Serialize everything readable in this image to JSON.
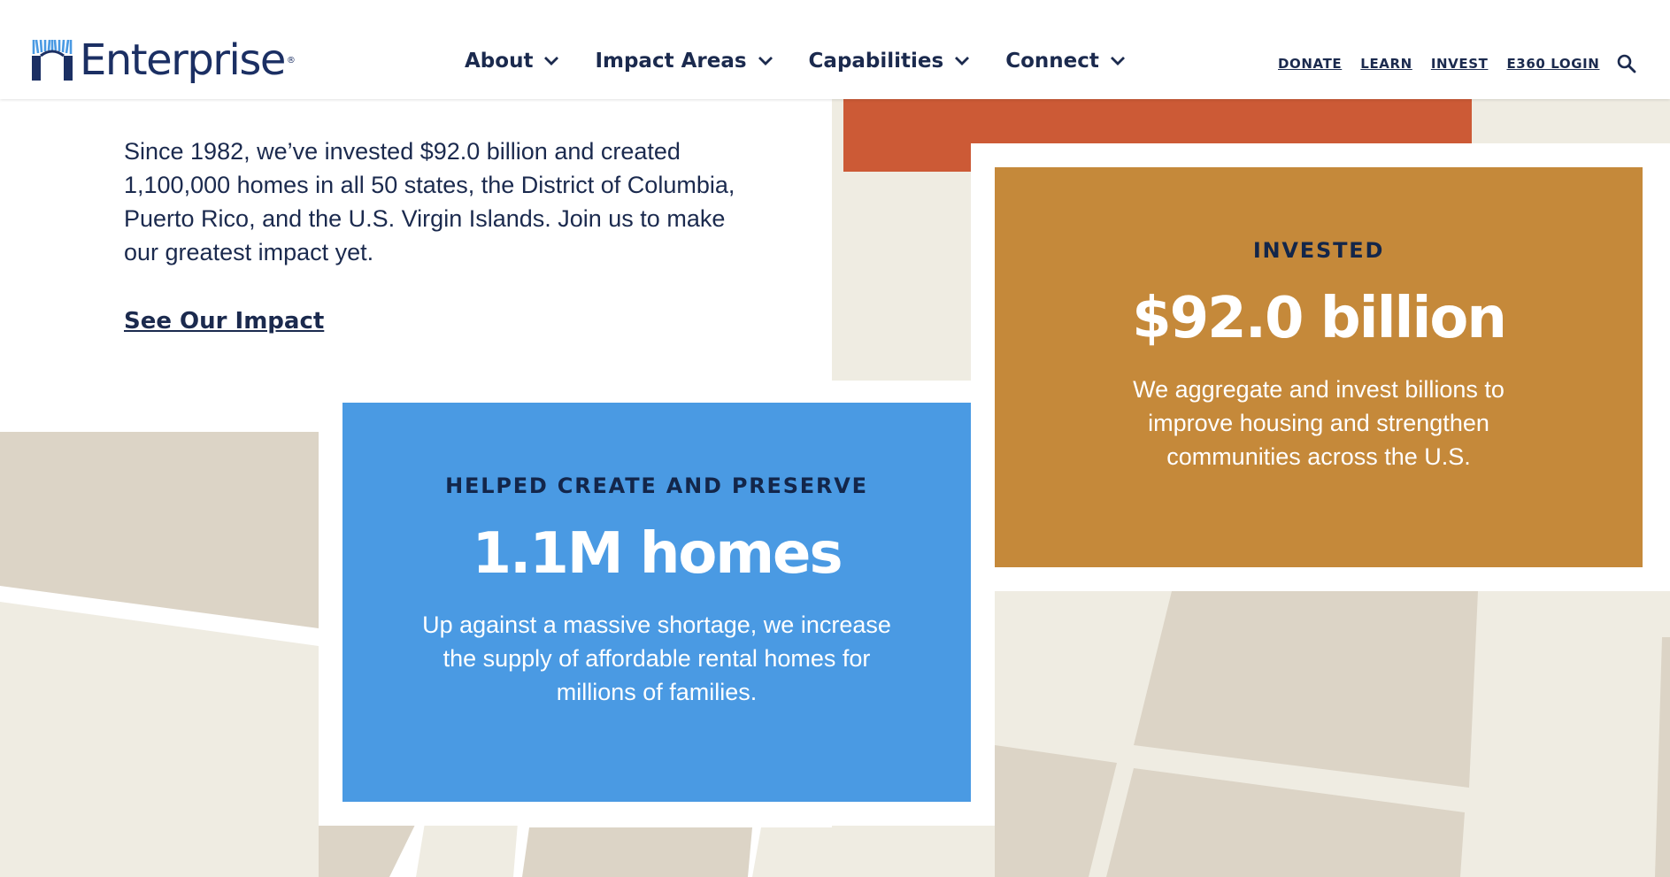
{
  "brand": {
    "name": "Enterprise",
    "reg_mark": "®"
  },
  "nav": {
    "main": [
      {
        "label": "About"
      },
      {
        "label": "Impact Areas"
      },
      {
        "label": "Capabilities"
      },
      {
        "label": "Connect"
      }
    ],
    "utility": [
      {
        "label": "DONATE"
      },
      {
        "label": "LEARN"
      },
      {
        "label": "INVEST"
      },
      {
        "label": "E360 LOGIN"
      }
    ],
    "icons": {
      "dropdown": "chevron-down-icon",
      "search": "search-icon"
    }
  },
  "intro": {
    "text": "Since 1982, we’ve invested $92.0 billion and created 1,100,000 homes in all 50 states, the District of Columbia, Puerto Rico, and the U.S. Virgin Islands. Join us to make our greatest impact yet.",
    "link": "See Our Impact"
  },
  "stats": {
    "homes": {
      "label": "HELPED CREATE AND PRESERVE",
      "value": "1.1M homes",
      "description": "Up against a massive shortage, we increase the supply of affordable rental homes for millions of families."
    },
    "invested": {
      "label": "INVESTED",
      "value": "$92.0 billion",
      "description": "We aggregate and invest billions to improve housing and strengthen communities across the U.S."
    }
  },
  "colors": {
    "navy": "#1b2a4e",
    "blue_card": "#4a9ae3",
    "gold_card": "#c5893a",
    "red_card": "#cc5a36",
    "map_light": "#efece2",
    "map_dark": "#dcd4c6"
  }
}
